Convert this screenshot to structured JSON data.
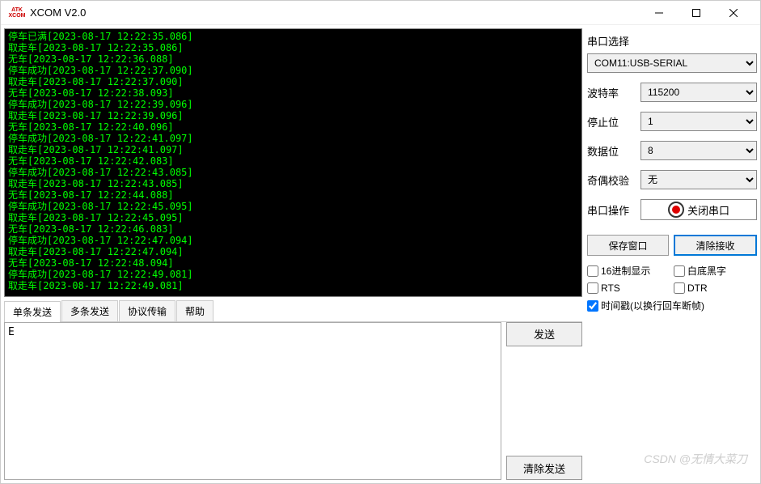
{
  "window": {
    "title": "XCOM V2.0"
  },
  "terminal_lines": [
    "停车已满[2023-08-17 12:22:35.086]",
    "取走车[2023-08-17 12:22:35.086]",
    "无车[2023-08-17 12:22:36.088]",
    "停车成功[2023-08-17 12:22:37.090]",
    "取走车[2023-08-17 12:22:37.090]",
    "无车[2023-08-17 12:22:38.093]",
    "停车成功[2023-08-17 12:22:39.096]",
    "取走车[2023-08-17 12:22:39.096]",
    "无车[2023-08-17 12:22:40.096]",
    "停车成功[2023-08-17 12:22:41.097]",
    "取走车[2023-08-17 12:22:41.097]",
    "无车[2023-08-17 12:22:42.083]",
    "停车成功[2023-08-17 12:22:43.085]",
    "取走车[2023-08-17 12:22:43.085]",
    "无车[2023-08-17 12:22:44.088]",
    "停车成功[2023-08-17 12:22:45.095]",
    "取走车[2023-08-17 12:22:45.095]",
    "无车[2023-08-17 12:22:46.083]",
    "停车成功[2023-08-17 12:22:47.094]",
    "取走车[2023-08-17 12:22:47.094]",
    "无车[2023-08-17 12:22:48.094]",
    "停车成功[2023-08-17 12:22:49.081]",
    "取走车[2023-08-17 12:22:49.081]"
  ],
  "tabs": {
    "single": "单条发送",
    "multi": "多条发送",
    "proto": "协议传输",
    "help": "帮助"
  },
  "send": {
    "value": "E",
    "send_btn": "发送",
    "clear_btn": "清除发送"
  },
  "port": {
    "title": "串口选择",
    "device": "COM11:USB-SERIAL",
    "baud_label": "波特率",
    "baud": "115200",
    "stop_label": "停止位",
    "stop": "1",
    "data_label": "数据位",
    "data": "8",
    "parity_label": "奇偶校验",
    "parity": "无",
    "op_label": "串口操作",
    "close_btn": "关闭串口"
  },
  "buttons": {
    "save": "保存窗口",
    "clear_rx": "清除接收"
  },
  "checks": {
    "hex": "16进制显示",
    "bw": "白底黑字",
    "rts": "RTS",
    "dtr": "DTR",
    "timestamp": "时间戳(以换行回车断帧)"
  },
  "watermark": "CSDN @无情大菜刀"
}
